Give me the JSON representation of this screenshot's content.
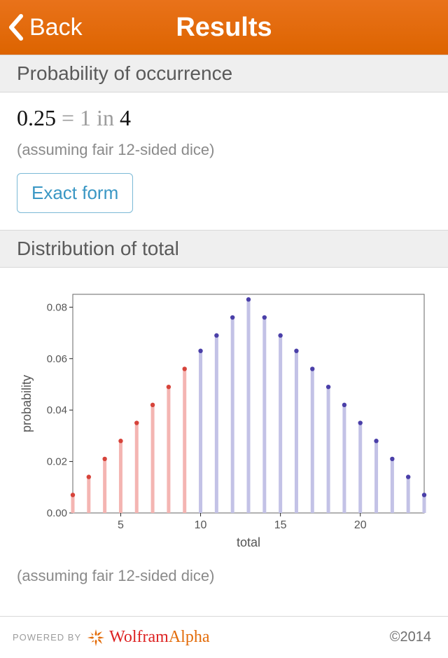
{
  "header": {
    "back_label": "Back",
    "title": "Results"
  },
  "section1": {
    "title": "Probability of occurrence",
    "value_a": "0.25",
    "eq": " = ",
    "one": "1",
    "in": " in ",
    "value_b": "4",
    "assume": "(assuming fair 12-sided dice)",
    "exact_form_label": "Exact form"
  },
  "section2": {
    "title": "Distribution of total",
    "assume": "(assuming fair 12-sided dice)"
  },
  "chart_data": {
    "type": "bar",
    "title": "",
    "xlabel": "total",
    "ylabel": "probability",
    "xlim": [
      2,
      24
    ],
    "ylim": [
      0.0,
      0.085
    ],
    "x_ticks": [
      5,
      10,
      15,
      20
    ],
    "y_ticks": [
      0.0,
      0.02,
      0.04,
      0.06,
      0.08
    ],
    "categories": [
      2,
      3,
      4,
      5,
      6,
      7,
      8,
      9,
      10,
      11,
      12,
      13,
      14,
      15,
      16,
      17,
      18,
      19,
      20,
      21,
      22,
      23,
      24
    ],
    "values": [
      0.007,
      0.014,
      0.021,
      0.028,
      0.035,
      0.042,
      0.049,
      0.056,
      0.063,
      0.069,
      0.076,
      0.083,
      0.076,
      0.069,
      0.063,
      0.056,
      0.049,
      0.042,
      0.035,
      0.028,
      0.021,
      0.014,
      0.007
    ],
    "highlight_upto_index": 7,
    "colors": {
      "highlight_fill": "#f4b5b2",
      "highlight_dot": "#d6433a",
      "normal_fill": "#c3c2e6",
      "normal_dot": "#4a3fa8",
      "axis": "#222",
      "frame": "#666",
      "labels": "#555"
    }
  },
  "footer": {
    "powered_by": "POWERED BY",
    "brand_a": "Wolfram",
    "brand_b": "Alpha",
    "copyright": "©2014"
  }
}
